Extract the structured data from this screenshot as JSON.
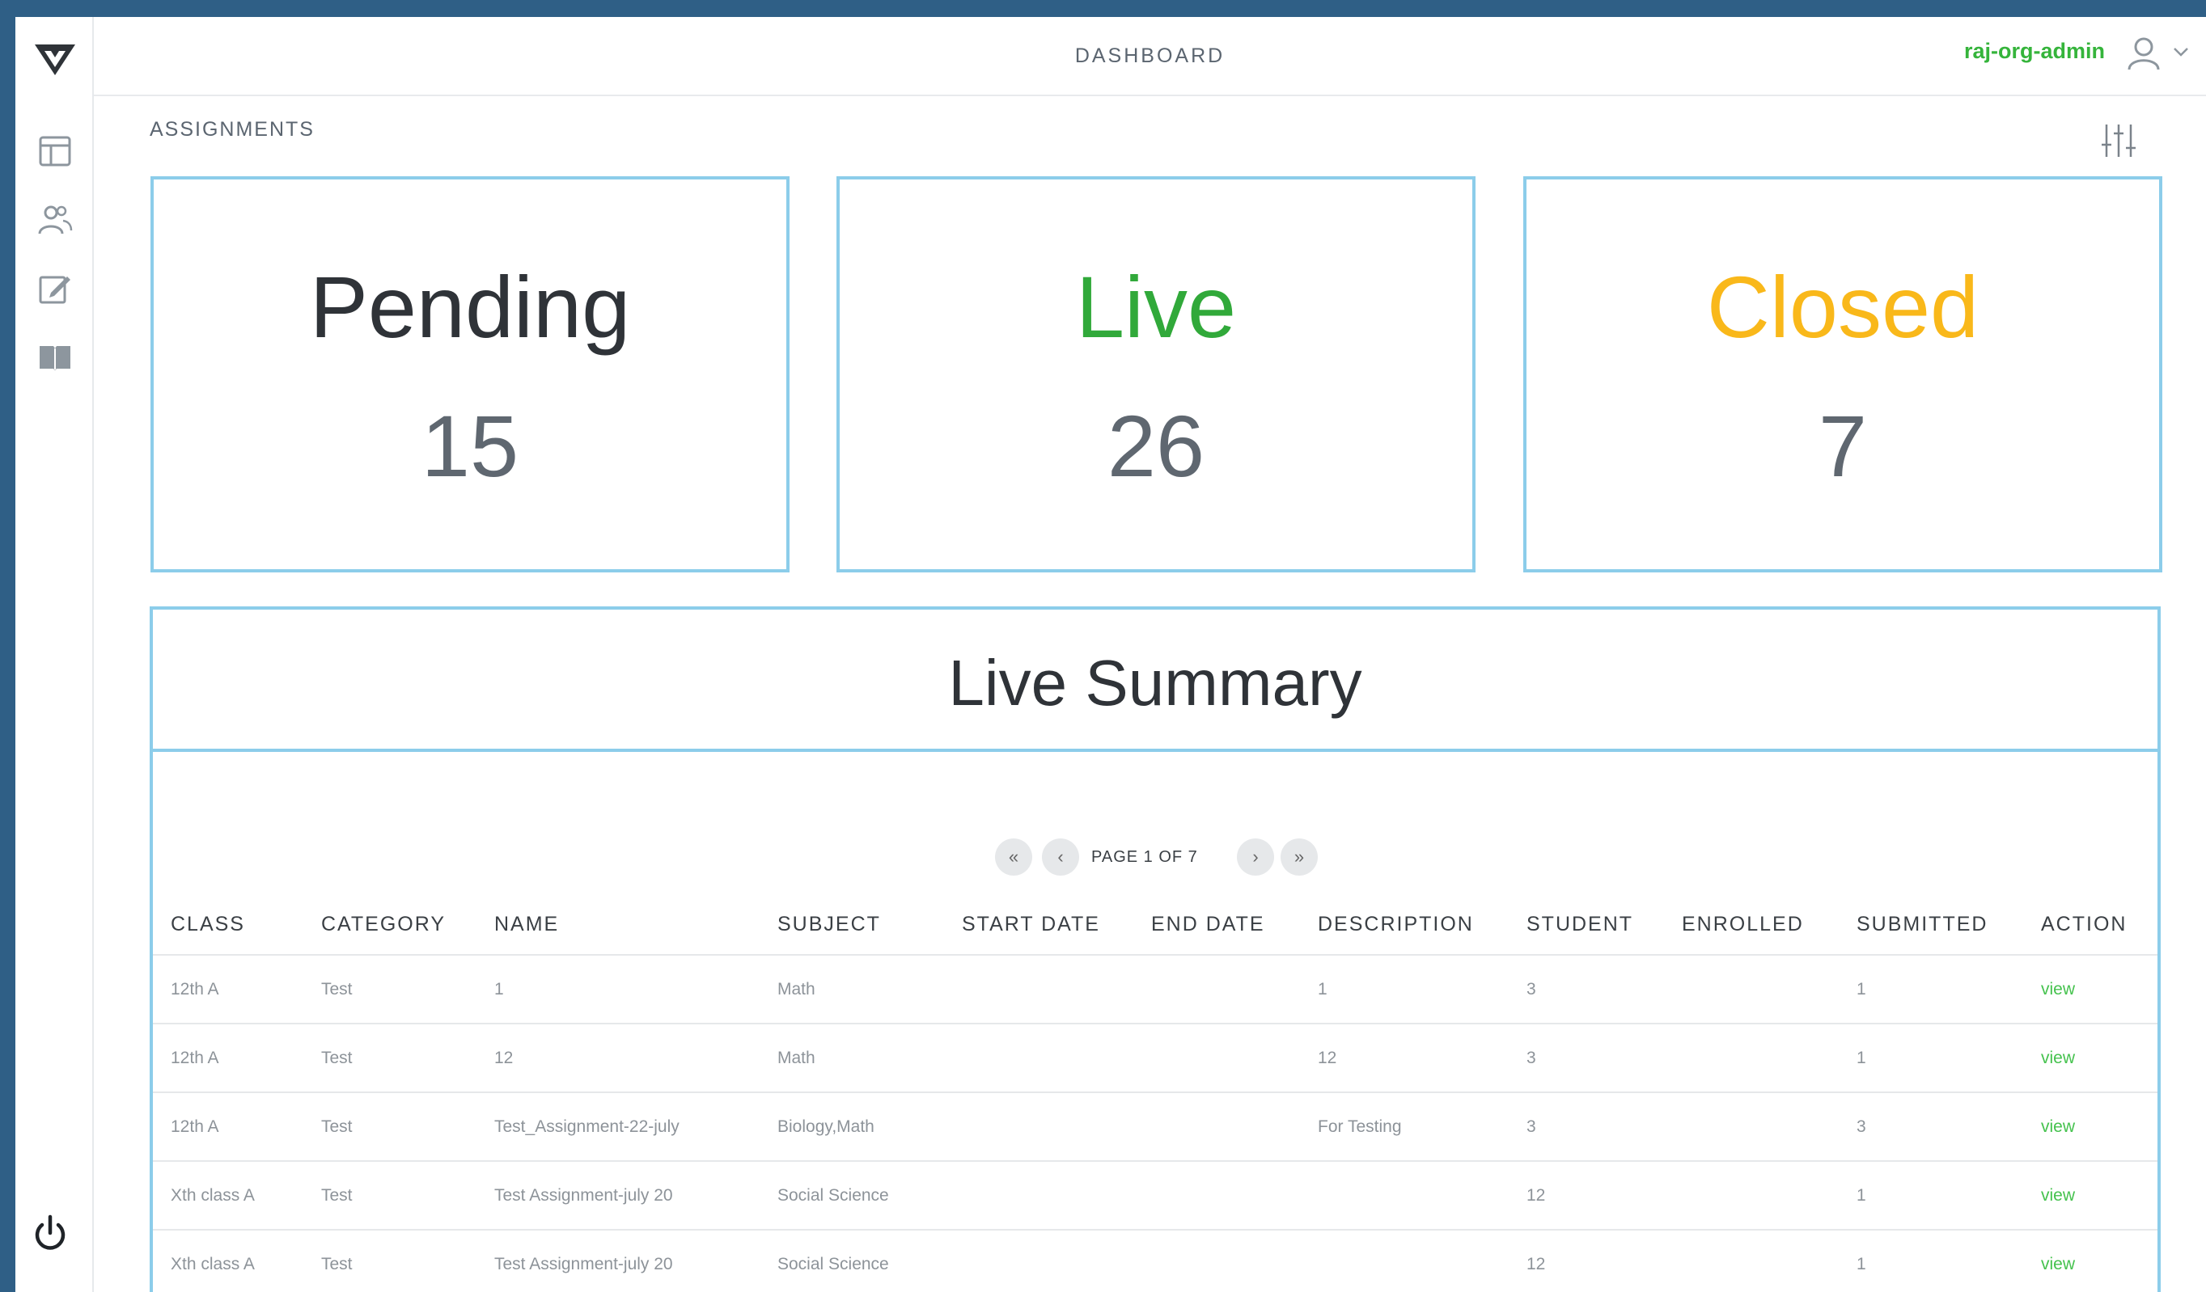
{
  "header": {
    "title": "DASHBOARD",
    "user_name": "raj-org-admin"
  },
  "sidebar": {
    "items": [
      {
        "icon": "layout-icon"
      },
      {
        "icon": "users-icon"
      },
      {
        "icon": "edit-icon"
      },
      {
        "icon": "book-icon"
      }
    ],
    "footer_icon": "power-icon"
  },
  "main": {
    "section_title": "ASSIGNMENTS",
    "cards": [
      {
        "label": "Pending",
        "value": "15",
        "color": "#2f3338"
      },
      {
        "label": "Live",
        "value": "26",
        "color": "#31a93a"
      },
      {
        "label": "Closed",
        "value": "7",
        "color": "#f9b81a"
      }
    ],
    "summary": {
      "title": "Live Summary",
      "pager": {
        "text": "PAGE 1 OF 7",
        "first": "«",
        "prev": "‹",
        "next": "›",
        "last": "»"
      },
      "columns": [
        "CLASS",
        "CATEGORY",
        "NAME",
        "SUBJECT",
        "START DATE",
        "END DATE",
        "DESCRIPTION",
        "STUDENT",
        "ENROLLED",
        "SUBMITTED",
        "ACTION"
      ],
      "rows": [
        [
          "12th A",
          "Test",
          "1",
          "Math",
          "",
          "",
          "1",
          "3",
          "",
          "1",
          "view"
        ],
        [
          "12th A",
          "Test",
          "12",
          "Math",
          "",
          "",
          "12",
          "3",
          "",
          "1",
          "view"
        ],
        [
          "12th A",
          "Test",
          "Test_Assignment-22-july",
          "Biology,Math",
          "",
          "",
          "For Testing",
          "3",
          "",
          "3",
          "view"
        ],
        [
          "Xth class A",
          "Test",
          "Test Assignment-july 20",
          "Social Science",
          "",
          "",
          "",
          "12",
          "",
          "1",
          "view"
        ],
        [
          "Xth class A",
          "Test",
          "Test Assignment-july 20",
          "Social Science",
          "",
          "",
          "",
          "12",
          "",
          "1",
          "view"
        ]
      ]
    }
  },
  "colors": {
    "accent": "#35b43b",
    "card_border": "#8ccdea",
    "frame": "#2f5f86"
  }
}
